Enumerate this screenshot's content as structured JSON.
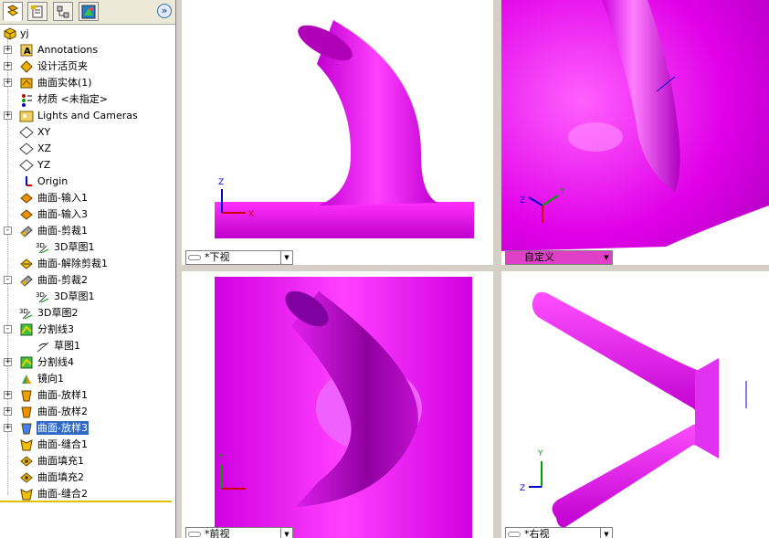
{
  "tabs": [
    {
      "name": "feature-manager-tab",
      "icon": "feature-tree-icon"
    },
    {
      "name": "property-manager-tab",
      "icon": "property-icon"
    },
    {
      "name": "configuration-manager-tab",
      "icon": "configuration-icon"
    },
    {
      "name": "display-manager-tab",
      "icon": "display-icon"
    }
  ],
  "expand_label": "»",
  "tree": {
    "root": "yj",
    "items": [
      {
        "label": "Annotations",
        "icon": "annotations-icon",
        "expander": "+"
      },
      {
        "label": "设计活页夹",
        "icon": "design-binder-icon",
        "expander": "+"
      },
      {
        "label": "曲面实体(1)",
        "icon": "surface-bodies-icon",
        "expander": "+"
      },
      {
        "label": "材质 <未指定>",
        "icon": "material-icon",
        "expander": ""
      },
      {
        "label": "Lights and Cameras",
        "icon": "lights-cameras-icon",
        "expander": "+"
      },
      {
        "label": "XY",
        "icon": "plane-icon",
        "expander": ""
      },
      {
        "label": "XZ",
        "icon": "plane-icon",
        "expander": ""
      },
      {
        "label": "YZ",
        "icon": "plane-icon",
        "expander": ""
      },
      {
        "label": "Origin",
        "icon": "origin-icon",
        "expander": ""
      },
      {
        "label": "曲面-输入1",
        "icon": "imported-surface-icon",
        "expander": ""
      },
      {
        "label": "曲面-输入3",
        "icon": "imported-surface-icon",
        "expander": ""
      },
      {
        "label": "曲面-剪裁1",
        "icon": "trim-surface-icon",
        "expander": "-"
      },
      {
        "label": "3D草图1",
        "icon": "3d-sketch-icon",
        "expander": "",
        "indent": 1
      },
      {
        "label": "曲面-解除剪裁1",
        "icon": "untrim-surface-icon",
        "expander": ""
      },
      {
        "label": "曲面-剪裁2",
        "icon": "trim-surface-icon",
        "expander": "-"
      },
      {
        "label": "3D草图1",
        "icon": "3d-sketch-icon",
        "expander": "",
        "indent": 1
      },
      {
        "label": "3D草图2",
        "icon": "3d-sketch-icon",
        "expander": ""
      },
      {
        "label": "分割线3",
        "icon": "split-line-icon",
        "expander": "-"
      },
      {
        "label": "草图1",
        "icon": "sketch-icon",
        "expander": "",
        "indent": 1
      },
      {
        "label": "分割线4",
        "icon": "split-line-icon",
        "expander": "+"
      },
      {
        "label": "镜向1",
        "icon": "mirror-icon",
        "expander": ""
      },
      {
        "label": "曲面-放样1",
        "icon": "loft-surface-icon",
        "expander": "+"
      },
      {
        "label": "曲面-放样2",
        "icon": "loft-surface-icon",
        "expander": "+"
      },
      {
        "label": "曲面-放样3",
        "icon": "loft-surface-icon",
        "expander": "+",
        "selected": true
      },
      {
        "label": "曲面-缝合1",
        "icon": "knit-surface-icon",
        "expander": ""
      },
      {
        "label": "曲面填充1",
        "icon": "fill-surface-icon",
        "expander": ""
      },
      {
        "label": "曲面填充2",
        "icon": "fill-surface-icon",
        "expander": ""
      },
      {
        "label": "曲面-缝合2",
        "icon": "knit-surface-icon",
        "expander": ""
      }
    ]
  },
  "viewports": {
    "top_left": {
      "view": "*下视",
      "axes": [
        "Z",
        "X"
      ]
    },
    "top_right": {
      "view": "自定义",
      "axes": [
        "Z",
        "Y",
        "X"
      ]
    },
    "bottom_left": {
      "view": "*前视",
      "axes": [
        "Y",
        "X"
      ]
    },
    "bottom_right": {
      "view": "*右视",
      "axes": [
        "Y",
        "Z"
      ]
    }
  },
  "colors": {
    "model": "#e000e8",
    "model_dark": "#a000b0",
    "model_light": "#ff80ff",
    "selection": "#316ac5",
    "axis_x": "#d00000",
    "axis_y": "#00a000",
    "axis_z": "#0000d0"
  }
}
